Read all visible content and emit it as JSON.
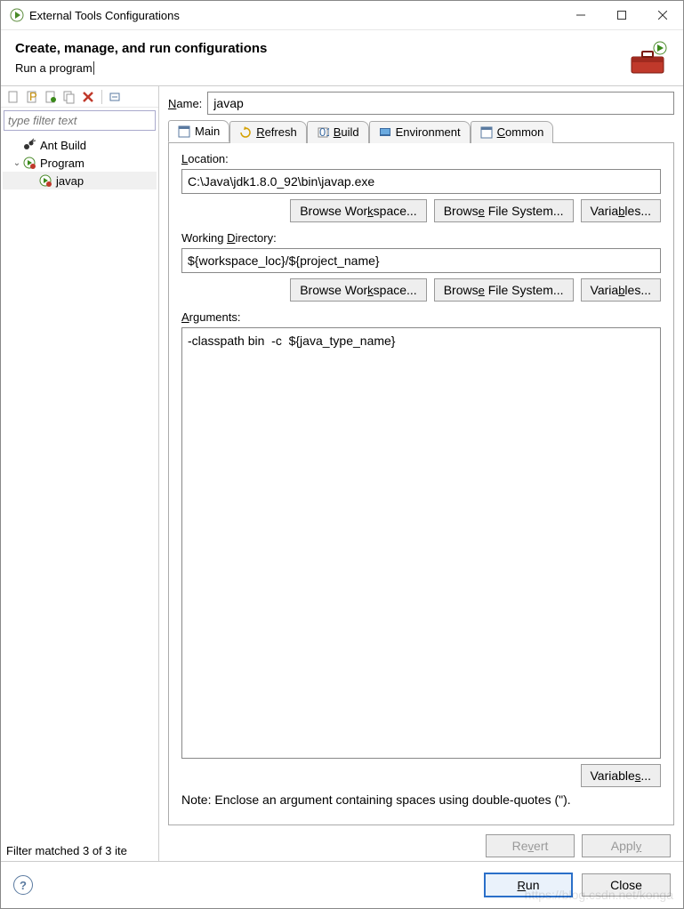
{
  "window": {
    "title": "External Tools Configurations"
  },
  "header": {
    "heading": "Create, manage, and run configurations",
    "subtitle": "Run a program"
  },
  "left": {
    "filter_placeholder": "type filter text",
    "tree": {
      "ant": "Ant Build",
      "program": "Program",
      "javap": "javap"
    },
    "status": "Filter matched 3 of 3 ite"
  },
  "form": {
    "name_label": "Name:",
    "name_value": "javap",
    "tabs": {
      "main": "Main",
      "refresh": "Refresh",
      "build": "Build",
      "environment": "Environment",
      "common": "Common"
    },
    "location": {
      "label": "Location:",
      "value": "C:\\Java\\jdk1.8.0_92\\bin\\javap.exe",
      "browse_ws": "Browse Workspace...",
      "browse_fs": "Browse File System...",
      "variables": "Variables..."
    },
    "wd": {
      "label": "Working Directory:",
      "value": "${workspace_loc}/${project_name}",
      "browse_ws": "Browse Workspace...",
      "browse_fs": "Browse File System...",
      "variables": "Variables..."
    },
    "args": {
      "label": "Arguments:",
      "value": "-classpath bin  -c  ${java_type_name}",
      "variables": "Variables...",
      "note": "Note: Enclose an argument containing spaces using double-quotes (\")."
    },
    "revert": "Revert",
    "apply": "Apply"
  },
  "footer": {
    "run": "Run",
    "close": "Close"
  },
  "watermark": "https://blog.csdn.net/konga"
}
